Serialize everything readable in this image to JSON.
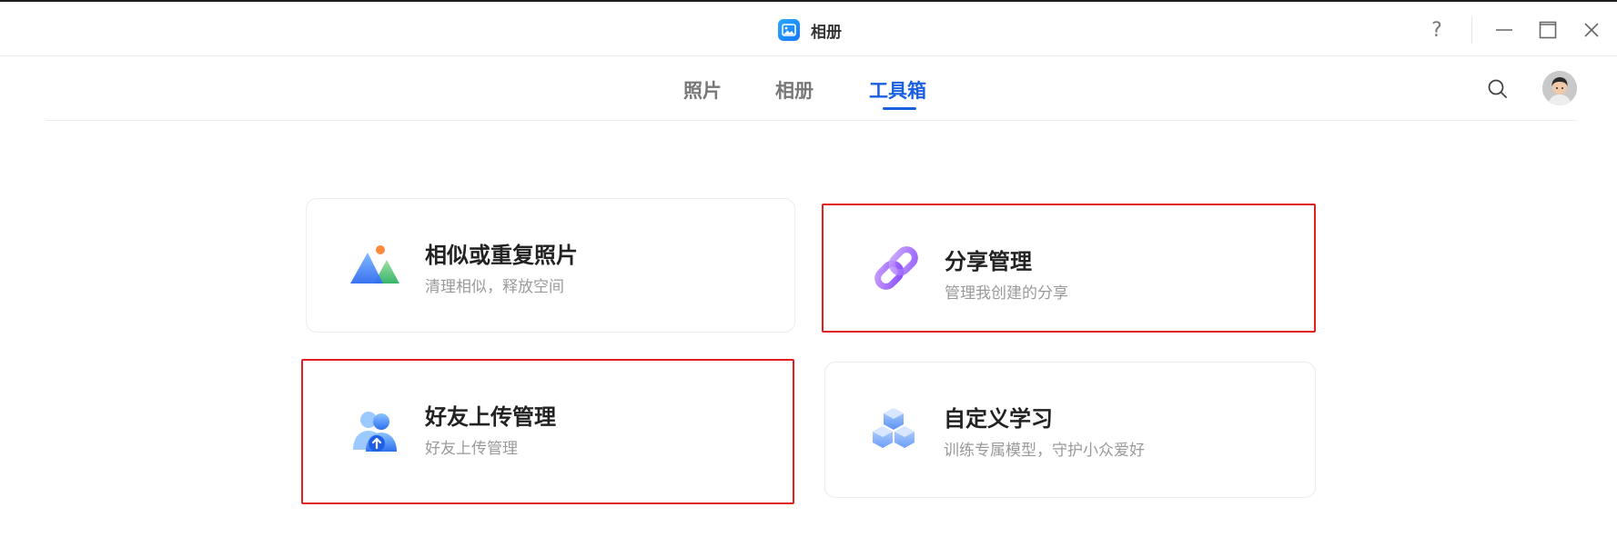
{
  "app": {
    "title": "相册"
  },
  "window_controls": {
    "help": "?"
  },
  "nav": {
    "tabs": [
      {
        "label": "照片",
        "active": false
      },
      {
        "label": "相册",
        "active": false
      },
      {
        "label": "工具箱",
        "active": true
      }
    ],
    "search_icon": "search-icon",
    "avatar_icon": "user-avatar"
  },
  "tools": [
    {
      "title": "相似或重复照片",
      "subtitle": "清理相似，释放空间",
      "icon": "mountain-photo-icon",
      "highlighted": false
    },
    {
      "title": "分享管理",
      "subtitle": "管理我创建的分享",
      "icon": "link-icon",
      "highlighted": true
    },
    {
      "title": "好友上传管理",
      "subtitle": "好友上传管理",
      "icon": "friends-upload-icon",
      "highlighted": true
    },
    {
      "title": "自定义学习",
      "subtitle": "训练专属模型，守护小众爱好",
      "icon": "cubes-icon",
      "highlighted": false
    }
  ],
  "colors": {
    "accent": "#1a5fe0",
    "highlight_border": "#e02020",
    "subtitle": "#9a9a9a"
  }
}
